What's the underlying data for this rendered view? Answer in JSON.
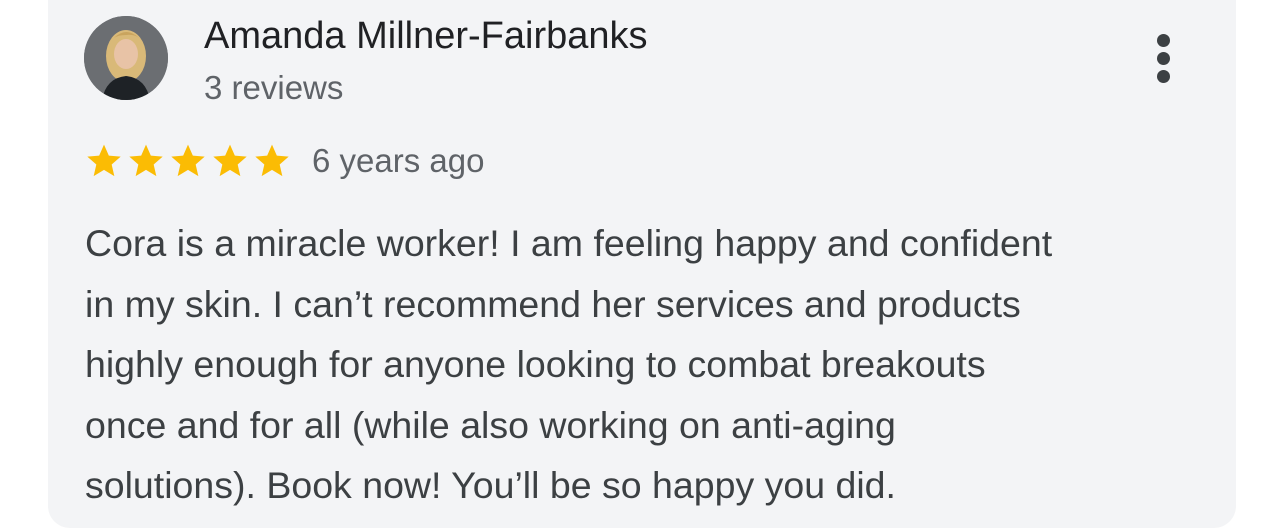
{
  "review": {
    "reviewer_name": "Amanda Millner-Fairbanks",
    "review_count": "3 reviews",
    "rating": 5,
    "rating_max": 5,
    "time_ago": "6 years ago",
    "text_lines": [
      "Cora is a miracle worker! I am feeling happy and confident",
      "in my skin. I can’t recommend her services and products",
      "highly enough for anyone looking to combat breakouts",
      "once and for all (while also working on anti-aging",
      "solutions). Book now! You’ll be so happy you did."
    ]
  },
  "icons": {
    "star": "star-icon",
    "more": "more-vert-icon"
  },
  "colors": {
    "card_background": "#f3f4f6",
    "star": "#fbbc04",
    "name_text": "#202124",
    "secondary_text": "#5f6368",
    "body_text": "#3c4043"
  }
}
